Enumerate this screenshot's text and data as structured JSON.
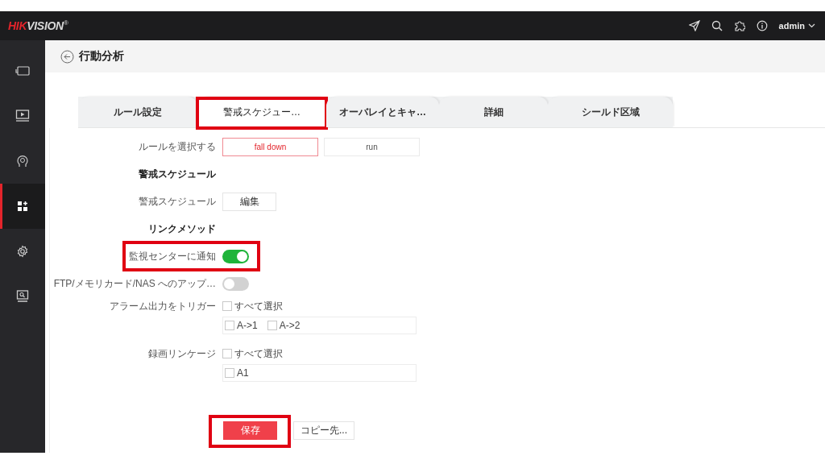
{
  "top_bar": {
    "logo": {
      "accent": "HIK",
      "rest": "VISION",
      "mark": "®"
    },
    "user": "admin"
  },
  "sidebar": {
    "items": [
      {
        "kind": "device",
        "selected": false
      },
      {
        "kind": "playback",
        "selected": false
      },
      {
        "kind": "ai",
        "selected": false
      },
      {
        "kind": "apps",
        "selected": true
      },
      {
        "kind": "settings",
        "selected": false
      },
      {
        "kind": "screen-search",
        "selected": false
      }
    ]
  },
  "page": {
    "title": "行動分析"
  },
  "tabs": [
    {
      "label": "ルール設定",
      "selected": false,
      "highlighted": false
    },
    {
      "label": "警戒スケジュー…",
      "selected": true,
      "highlighted": true
    },
    {
      "label": "オーバレイとキャ…",
      "selected": false,
      "highlighted": false
    },
    {
      "label": "詳細",
      "selected": false,
      "highlighted": false
    },
    {
      "label": "シールド区域",
      "selected": false,
      "highlighted": false
    }
  ],
  "rule_select": {
    "label": "ルールを選択する",
    "options": [
      {
        "label": "fall down",
        "selected": true
      },
      {
        "label": "run",
        "selected": false
      }
    ]
  },
  "schedule": {
    "heading": "警戒スケジュール",
    "label": "警戒スケジュール",
    "button": "編集"
  },
  "linkage": {
    "heading": "リンクメソッド",
    "toggles": [
      {
        "label": "監視センターに通知",
        "on": true,
        "highlighted": true
      },
      {
        "label": "FTP/メモリカード/NAS へのアップ…",
        "on": false,
        "highlighted": false
      }
    ],
    "groups": [
      {
        "label": "アラーム出力をトリガー",
        "select_all": {
          "label": "すべて選択",
          "checked": false
        },
        "items": [
          {
            "label": "A->1",
            "checked": false
          },
          {
            "label": "A->2",
            "checked": false
          }
        ]
      },
      {
        "label": "録画リンケージ",
        "select_all": {
          "label": "すべて選択",
          "checked": false
        },
        "items": [
          {
            "label": "A1",
            "checked": false
          }
        ]
      }
    ]
  },
  "buttons": [
    {
      "label": "保存",
      "kind": "primary",
      "highlighted": true
    },
    {
      "label": "コピー先...",
      "kind": "secondary",
      "highlighted": false
    }
  ]
}
